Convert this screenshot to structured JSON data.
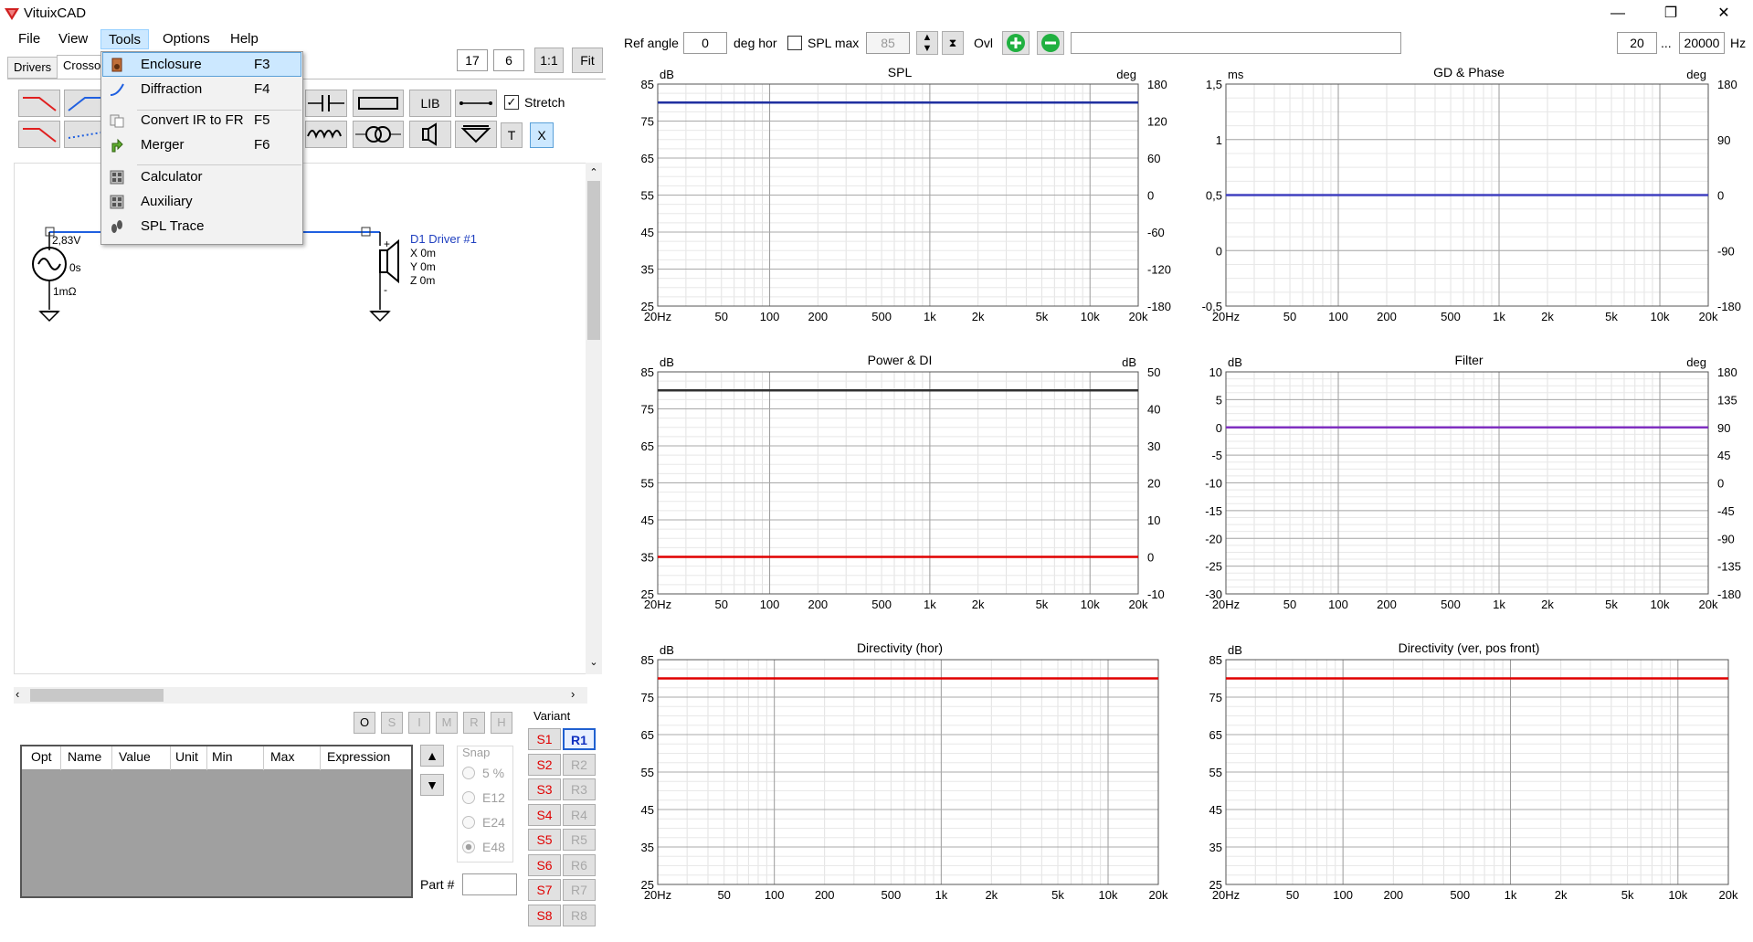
{
  "app": {
    "title": "VituixCAD"
  },
  "window_controls": {
    "minimize": "—",
    "restore": "❐",
    "close": "✕"
  },
  "menu": {
    "file": "File",
    "view": "View",
    "tools": "Tools",
    "options": "Options",
    "help": "Help"
  },
  "tools_menu": [
    {
      "label": "Enclosure",
      "key": "F3",
      "icon": "enclosure-icon"
    },
    {
      "label": "Diffraction",
      "key": "F4",
      "icon": "diffraction-icon"
    },
    {
      "label": "Convert IR to FR",
      "key": "F5",
      "icon": "convert-icon"
    },
    {
      "label": "Merger",
      "key": "F6",
      "icon": "merger-icon"
    },
    {
      "label": "Calculator",
      "key": "",
      "icon": "calculator-icon"
    },
    {
      "label": "Auxiliary",
      "key": "",
      "icon": "auxiliary-icon"
    },
    {
      "label": "SPL Trace",
      "key": "",
      "icon": "spl-trace-icon"
    }
  ],
  "tabs": {
    "drivers": "Drivers",
    "crossover": "Crosso"
  },
  "zoom": {
    "val1": "17",
    "val2": "6",
    "one_to_one": "1:1",
    "fit": "Fit"
  },
  "toolbar": {
    "lib": "LIB",
    "stretch": "Stretch",
    "t": "T",
    "x": "X"
  },
  "schematic": {
    "source_voltage": "2,83V",
    "source_delay": "0s",
    "source_resistance": "1mΩ",
    "driver_name": "D1 Driver #1",
    "driver_x": "X 0m",
    "driver_y": "Y 0m",
    "driver_z": "Z 0m",
    "plus": "+",
    "minus": "-"
  },
  "mode_buttons": [
    "O",
    "S",
    "I",
    "M",
    "R",
    "H"
  ],
  "opt_table": {
    "columns": [
      "Opt",
      "Name",
      "Value",
      "Unit",
      "Min",
      "Max",
      "Expression"
    ]
  },
  "snap": {
    "label": "Snap",
    "options": [
      "5 %",
      "E12",
      "E24",
      "E48"
    ],
    "selected": "E48"
  },
  "part": {
    "label": "Part #",
    "value": ""
  },
  "variant": {
    "label": "Variant",
    "s": [
      "S1",
      "S2",
      "S3",
      "S4",
      "S5",
      "S6",
      "S7",
      "S8"
    ],
    "r": [
      "R1",
      "R2",
      "R3",
      "R4",
      "R5",
      "R6",
      "R7",
      "R8"
    ],
    "active_r": "R1"
  },
  "top": {
    "ref_angle_label": "Ref angle",
    "ref_angle": "0",
    "deg_hor": "deg hor",
    "spl_max_label": "SPL max",
    "spl_max": "85",
    "ovl": "Ovl",
    "freq_min": "20",
    "freq_sep": "...",
    "freq_max": "20000",
    "hz": "Hz"
  },
  "x_ticks": [
    "20Hz",
    "50",
    "100",
    "200",
    "500",
    "1k",
    "2k",
    "5k",
    "10k",
    "20k"
  ],
  "charts": [
    {
      "title": "SPL",
      "left_unit": "dB",
      "right_unit": "deg",
      "left_ticks": [
        "85",
        "75",
        "65",
        "55",
        "45",
        "35",
        "25"
      ],
      "right_ticks": [
        "180",
        "120",
        "60",
        "0",
        "-60",
        "-120",
        "-180"
      ],
      "lines": [
        {
          "value": 80,
          "color": "#2030a0"
        }
      ],
      "left_range": [
        25,
        85
      ]
    },
    {
      "title": "GD & Phase",
      "left_unit": "ms",
      "right_unit": "deg",
      "left_ticks": [
        "1,5",
        "1",
        "0,5",
        "0",
        "-0,5"
      ],
      "right_ticks": [
        "180",
        "90",
        "0",
        "-90",
        "-180"
      ],
      "lines": [
        {
          "value": 0.5,
          "color": "#4040c0"
        }
      ],
      "left_range": [
        -0.5,
        1.5
      ]
    },
    {
      "title": "Power & DI",
      "left_unit": "dB",
      "right_unit": "dB",
      "left_ticks": [
        "85",
        "75",
        "65",
        "55",
        "45",
        "35",
        "25"
      ],
      "right_ticks": [
        "50",
        "40",
        "30",
        "20",
        "10",
        "0",
        "-10"
      ],
      "lines": [
        {
          "value": 80,
          "color": "#303030"
        },
        {
          "value": 35,
          "color": "#e00000"
        }
      ],
      "left_range": [
        25,
        85
      ]
    },
    {
      "title": "Filter",
      "left_unit": "dB",
      "right_unit": "deg",
      "left_ticks": [
        "10",
        "5",
        "0",
        "-5",
        "-10",
        "-15",
        "-20",
        "-25",
        "-30"
      ],
      "right_ticks": [
        "180",
        "135",
        "90",
        "45",
        "0",
        "-45",
        "-90",
        "-135",
        "-180"
      ],
      "lines": [
        {
          "value": 0,
          "color": "#8030c0"
        }
      ],
      "left_range": [
        -30,
        10
      ]
    },
    {
      "title": "Directivity (hor)",
      "left_unit": "dB",
      "right_unit": "",
      "left_ticks": [
        "85",
        "75",
        "65",
        "55",
        "45",
        "35",
        "25"
      ],
      "right_ticks": [],
      "lines": [
        {
          "value": 80,
          "color": "#e00000"
        }
      ],
      "left_range": [
        25,
        85
      ]
    },
    {
      "title": "Directivity (ver, pos front)",
      "left_unit": "dB",
      "right_unit": "",
      "left_ticks": [
        "85",
        "75",
        "65",
        "55",
        "45",
        "35",
        "25"
      ],
      "right_ticks": [],
      "lines": [
        {
          "value": 80,
          "color": "#e00000"
        }
      ],
      "left_range": [
        25,
        85
      ]
    }
  ]
}
